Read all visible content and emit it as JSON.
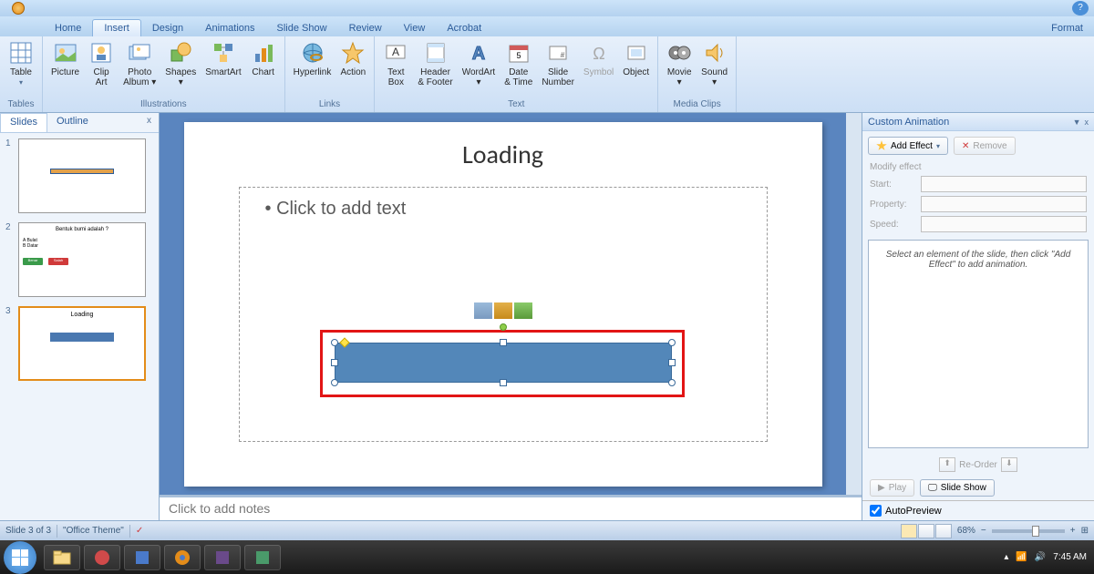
{
  "tabs": {
    "items": [
      "Home",
      "Insert",
      "Design",
      "Animations",
      "Slide Show",
      "Review",
      "View",
      "Acrobat"
    ],
    "format": "Format",
    "active": "Insert"
  },
  "help": "?",
  "ribbon": {
    "tables": {
      "label": "Tables",
      "table": "Table"
    },
    "illustrations": {
      "label": "Illustrations",
      "picture": "Picture",
      "clipart": "Clip\nArt",
      "photo": "Photo\nAlbum ▾",
      "shapes": "Shapes\n▾",
      "smartart": "SmartArt",
      "chart": "Chart"
    },
    "links": {
      "label": "Links",
      "hyperlink": "Hyperlink",
      "action": "Action"
    },
    "text": {
      "label": "Text",
      "textbox": "Text\nBox",
      "header": "Header\n& Footer",
      "wordart": "WordArt\n▾",
      "date": "Date\n& Time",
      "slidenum": "Slide\nNumber",
      "symbol": "Symbol",
      "object": "Object"
    },
    "media": {
      "label": "Media Clips",
      "movie": "Movie\n▾",
      "sound": "Sound\n▾"
    }
  },
  "slidesPanel": {
    "slides": "Slides",
    "outline": "Outline",
    "close": "x",
    "thumb1_title": "",
    "thumb2_title": "Bentuk bumi adalah ?",
    "thumb2_opt1": "A Bulat",
    "thumb2_opt2": "B Datar",
    "thumb2_btn1": "Benar",
    "thumb2_btn2": "Salah",
    "thumb3_title": "Loading"
  },
  "slide": {
    "title": "Loading",
    "placeholder": "Click to add text"
  },
  "notes": "Click to add notes",
  "anim": {
    "title": "Custom Animation",
    "closeCaret": "▼",
    "closeX": "x",
    "addEffect": "Add Effect",
    "remove": "Remove",
    "modify": "Modify effect",
    "start": "Start:",
    "property": "Property:",
    "speed": "Speed:",
    "hint": "Select an element of the slide, then click \"Add Effect\" to add animation.",
    "reorder": "Re-Order",
    "up": "⬆",
    "down": "⬇",
    "play": "Play",
    "slideshow": "Slide Show",
    "autoprev": "AutoPreview"
  },
  "status": {
    "slideinfo": "Slide 3 of 3",
    "theme": "\"Office Theme\"",
    "zoom": "68%",
    "fit": "⊞"
  },
  "tray": {
    "time": "7:45 AM"
  }
}
